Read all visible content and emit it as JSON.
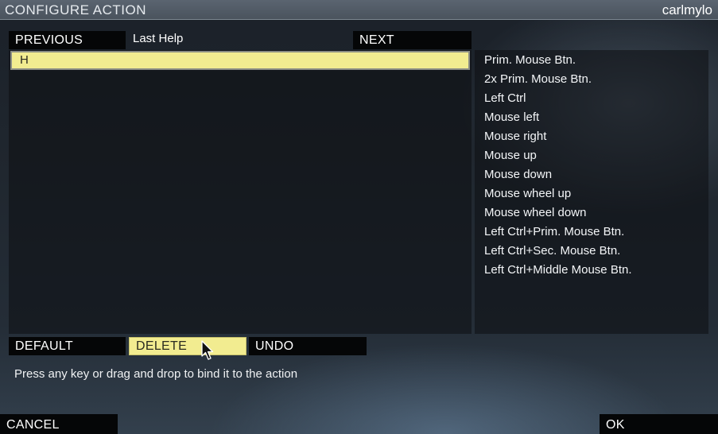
{
  "header": {
    "title": "CONFIGURE ACTION",
    "username": "carlmylo"
  },
  "nav": {
    "previous_label": "PREVIOUS",
    "help_label": "Last Help",
    "next_label": "NEXT"
  },
  "binding": {
    "current_key": "H"
  },
  "actions": {
    "items": [
      "Prim. Mouse Btn.",
      "2x Prim. Mouse Btn.",
      "Left Ctrl",
      "Mouse left",
      "Mouse right",
      "Mouse up",
      "Mouse down",
      "Mouse wheel up",
      "Mouse wheel down",
      "Left Ctrl+Prim. Mouse Btn.",
      "Left Ctrl+Sec. Mouse Btn.",
      "Left Ctrl+Middle Mouse Btn."
    ]
  },
  "controls": {
    "default_label": "DEFAULT",
    "delete_label": "DELETE",
    "undo_label": "UNDO",
    "hint": "Press any key or drag and drop to bind it to the action"
  },
  "footer": {
    "cancel_label": "CANCEL",
    "ok_label": "OK"
  },
  "colors": {
    "highlight": "#f2ec90",
    "button_bg": "#050607",
    "titlebar": "#4f5963"
  }
}
